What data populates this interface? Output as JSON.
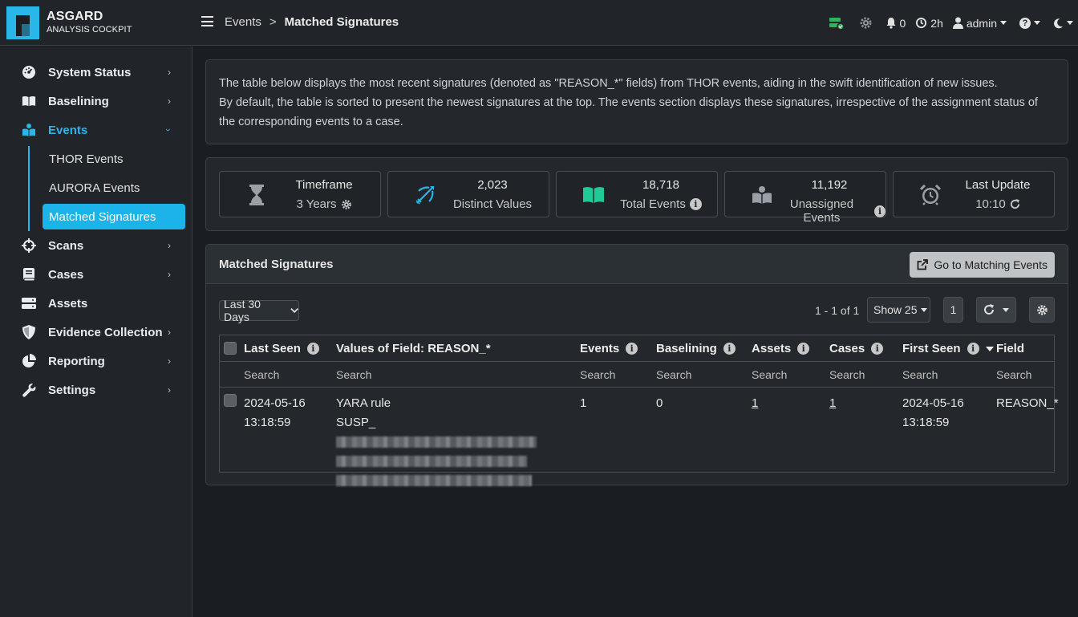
{
  "brand": {
    "line1": "ASGARD",
    "line2": "ANALYSIS COCKPIT"
  },
  "breadcrumb": {
    "parent": "Events",
    "separator": ">",
    "current": "Matched Signatures"
  },
  "topbar": {
    "notifications": "0",
    "timer": "2h",
    "user": "admin"
  },
  "sidebar": {
    "items": [
      {
        "label": "System Status",
        "icon": "gauge-icon"
      },
      {
        "label": "Baselining",
        "icon": "book-open-icon"
      },
      {
        "label": "Events",
        "icon": "events-icon"
      },
      {
        "label": "Scans",
        "icon": "crosshair-icon"
      },
      {
        "label": "Cases",
        "icon": "book-icon"
      },
      {
        "label": "Assets",
        "icon": "server-icon"
      },
      {
        "label": "Evidence Collection",
        "icon": "shield-icon"
      },
      {
        "label": "Reporting",
        "icon": "pie-chart-icon"
      },
      {
        "label": "Settings",
        "icon": "wrench-icon"
      }
    ],
    "subitems": [
      "THOR Events",
      "AURORA Events",
      "Matched Signatures"
    ],
    "accent": "#29b6e8"
  },
  "info": {
    "line1": "The table below displays the most recent signatures (denoted as \"REASON_*\" fields) from THOR events, aiding in the swift identification of new issues.",
    "line2": "By default, the table is sorted to present the newest signatures at the top. The events section displays these signatures, irrespective of the assignment status of the corresponding events to a case."
  },
  "stats": [
    {
      "top": "Timeframe",
      "bottom": "3 Years",
      "icon": "hourglass-icon"
    },
    {
      "top": "2,023",
      "bottom": "Distinct Values",
      "icon": "bow-arrow-icon"
    },
    {
      "top": "18,718",
      "bottom": "Total Events",
      "icon": "open-book-icon"
    },
    {
      "top": "11,192",
      "bottom": "Unassigned Events",
      "icon": "reader-icon"
    },
    {
      "top": "Last Update",
      "bottom": "10:10",
      "icon": "alarm-clock-icon"
    }
  ],
  "table_card": {
    "title": "Matched Signatures",
    "goto_label": "Go to Matching Events",
    "range_filter": "Last 30 Days",
    "pager_text": "1 - 1 of 1",
    "show_label": "Show 25",
    "page": "1"
  },
  "table": {
    "columns": [
      "Last Seen",
      "Values of Field: REASON_*",
      "Events",
      "Baselining",
      "Assets",
      "Cases",
      "First Seen",
      "Field"
    ],
    "search_placeholder": "Search",
    "rows": [
      {
        "last_seen_date": "2024-05-16",
        "last_seen_time": "13:18:59",
        "value_line1": "YARA rule",
        "value_line2": "SUSP_",
        "events": "1",
        "baselining": "0",
        "assets": "1",
        "cases": "1",
        "first_seen_date": "2024-05-16",
        "first_seen_time": "13:18:59",
        "field": "REASON_*"
      }
    ]
  }
}
